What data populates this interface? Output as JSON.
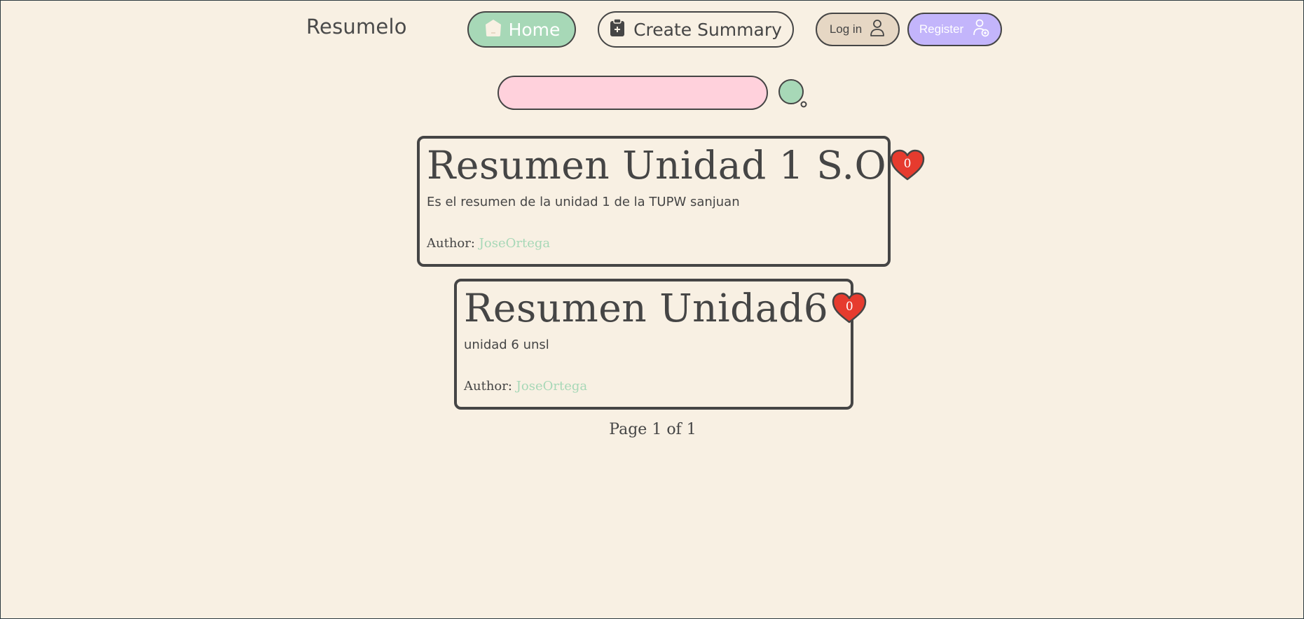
{
  "header": {
    "brand": "Resumelo",
    "nav": {
      "home_label": "Home",
      "create_label": "Create Summary",
      "login_label": "Log in",
      "register_label": "Register"
    }
  },
  "search": {
    "value": "",
    "placeholder": ""
  },
  "summaries": [
    {
      "title": "Resumen Unidad 1 S.O",
      "likes": "0",
      "description": "Es el resumen de la unidad 1 de la TUPW sanjuan",
      "author_label": "Author:",
      "author": "JoseOrtega"
    },
    {
      "title": "Resumen Unidad6",
      "likes": "0",
      "description": "unidad 6 unsl",
      "author_label": "Author:",
      "author": "JoseOrtega"
    }
  ],
  "pagination": {
    "text": "Page 1 of 1"
  },
  "colors": {
    "background": "#f8f0e3",
    "home_button": "#a7d8b7",
    "search_field": "#ffd1dc",
    "register_button": "#c3b5fb",
    "login_button": "#e6d7c4",
    "heart": "#e63b2e",
    "author_link": "#a7d8b7"
  },
  "icons": {
    "home": "home-icon",
    "create": "clipboard-plus-icon",
    "login": "user-icon",
    "register": "user-add-icon",
    "search": "magnifier-icon",
    "like": "heart-icon"
  }
}
